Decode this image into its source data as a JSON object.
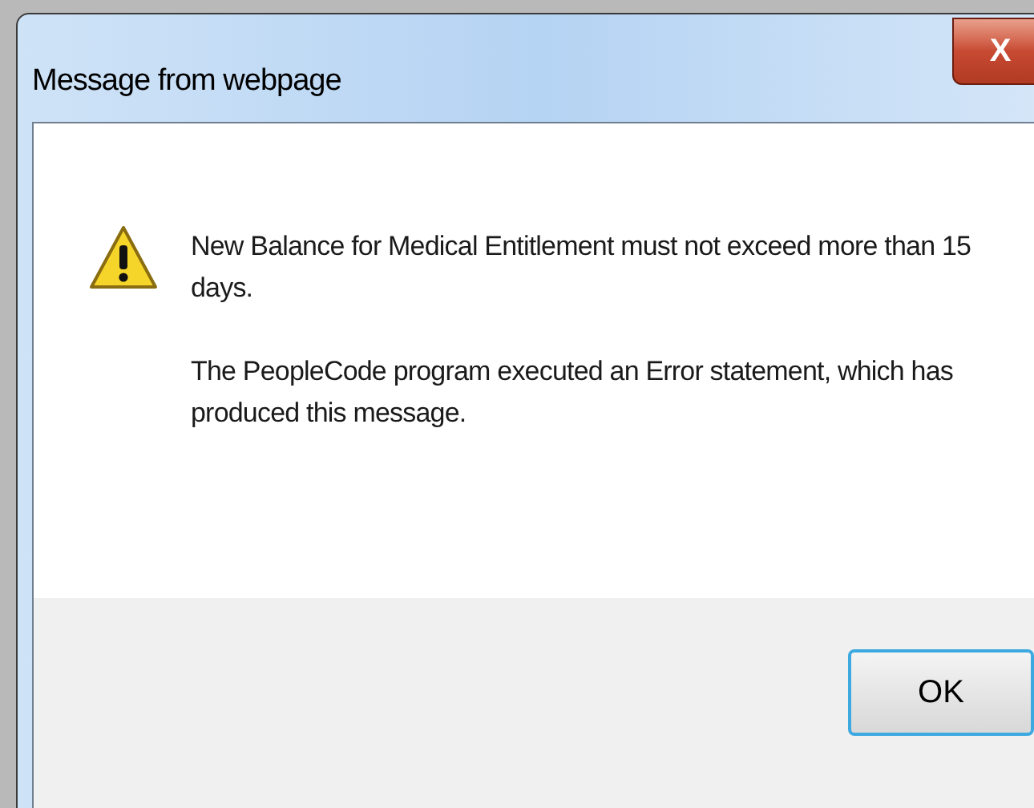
{
  "window": {
    "title": "Message from webpage",
    "close_label": "X"
  },
  "message": {
    "kind": "warning",
    "paragraphs": [
      "New Balance for Medical Entitlement must not exceed more than 15 days.",
      "The PeopleCode program executed an Error statement, which has produced this message."
    ]
  },
  "buttons": [
    {
      "label": "OK",
      "selected": true
    }
  ]
}
